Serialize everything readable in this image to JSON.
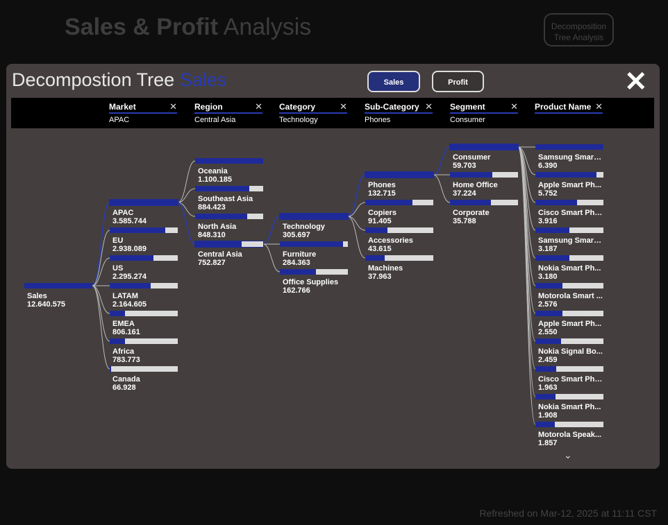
{
  "app": {
    "title_bold": "Sales & Profit",
    "title_light": "Analysis",
    "nav_button_line1": "Decomposition",
    "nav_button_line2": "Tree Analysis",
    "refreshed": "Refreshed on Mar-12, 2025 at 11:11 CST"
  },
  "panel": {
    "title": "Decompostion Tree",
    "measure": "Sales",
    "toggle_sales": "Sales",
    "toggle_profit": "Profit",
    "close_icon": "close-icon"
  },
  "levels": [
    {
      "label": "Market",
      "value": "APAC"
    },
    {
      "label": "Region",
      "value": "Central Asia"
    },
    {
      "label": "Category",
      "value": "Technology"
    },
    {
      "label": "Sub-Category",
      "value": "Phones"
    },
    {
      "label": "Segment",
      "value": "Consumer"
    },
    {
      "label": "Product Name",
      "value": ""
    }
  ],
  "colors": {
    "fill": "#1f2a9a",
    "track": "#dcdcdc",
    "accent": "#2a3bb4"
  },
  "tree": {
    "root": {
      "label": "Sales",
      "value": "12.640.575",
      "fraction": 1
    },
    "columns": [
      [
        {
          "label": "APAC",
          "value": "3.585.744",
          "fraction": 1,
          "active": true
        },
        {
          "label": "EU",
          "value": "2.938.089",
          "fraction": 0.82
        },
        {
          "label": "US",
          "value": "2.295.274",
          "fraction": 0.64
        },
        {
          "label": "LATAM",
          "value": "2.164.605",
          "fraction": 0.6
        },
        {
          "label": "EMEA",
          "value": "806.161",
          "fraction": 0.22
        },
        {
          "label": "Africa",
          "value": "783.773",
          "fraction": 0.22
        },
        {
          "label": "Canada",
          "value": "66.928",
          "fraction": 0.02
        }
      ],
      [
        {
          "label": "Oceania",
          "value": "1.100.185",
          "fraction": 1
        },
        {
          "label": "Southeast Asia",
          "value": "884.423",
          "fraction": 0.8
        },
        {
          "label": "North Asia",
          "value": "848.310",
          "fraction": 0.77
        },
        {
          "label": "Central Asia",
          "value": "752.827",
          "fraction": 0.68,
          "active": true
        }
      ],
      [
        {
          "label": "Technology",
          "value": "305.697",
          "fraction": 1,
          "active": true
        },
        {
          "label": "Furniture",
          "value": "284.363",
          "fraction": 0.93
        },
        {
          "label": "Office Supplies",
          "value": "162.766",
          "fraction": 0.53
        }
      ],
      [
        {
          "label": "Phones",
          "value": "132.715",
          "fraction": 1,
          "active": true
        },
        {
          "label": "Copiers",
          "value": "91.405",
          "fraction": 0.69
        },
        {
          "label": "Accessories",
          "value": "43.615",
          "fraction": 0.33
        },
        {
          "label": "Machines",
          "value": "37.963",
          "fraction": 0.29
        }
      ],
      [
        {
          "label": "Consumer",
          "value": "59.703",
          "fraction": 1,
          "active": true
        },
        {
          "label": "Home Office",
          "value": "37.224",
          "fraction": 0.62
        },
        {
          "label": "Corporate",
          "value": "35.788",
          "fraction": 0.6
        }
      ],
      [
        {
          "label": "Samsung Smart ...",
          "value": "6.390",
          "fraction": 1
        },
        {
          "label": "Apple Smart Ph...",
          "value": "5.752",
          "fraction": 0.9
        },
        {
          "label": "Cisco Smart Pho...",
          "value": "3.916",
          "fraction": 0.61
        },
        {
          "label": "Samsung Smart ...",
          "value": "3.187",
          "fraction": 0.5
        },
        {
          "label": "Nokia Smart Ph...",
          "value": "3.180",
          "fraction": 0.5
        },
        {
          "label": "Motorola Smart ...",
          "value": "2.576",
          "fraction": 0.4
        },
        {
          "label": "Apple Smart Ph...",
          "value": "2.550",
          "fraction": 0.4
        },
        {
          "label": "Nokia Signal Bo...",
          "value": "2.459",
          "fraction": 0.38
        },
        {
          "label": "Cisco Smart Pho...",
          "value": "1.963",
          "fraction": 0.31
        },
        {
          "label": "Nokia Smart Ph...",
          "value": "1.908",
          "fraction": 0.3
        },
        {
          "label": "Motorola Speak...",
          "value": "1.857",
          "fraction": 0.29
        }
      ]
    ]
  }
}
